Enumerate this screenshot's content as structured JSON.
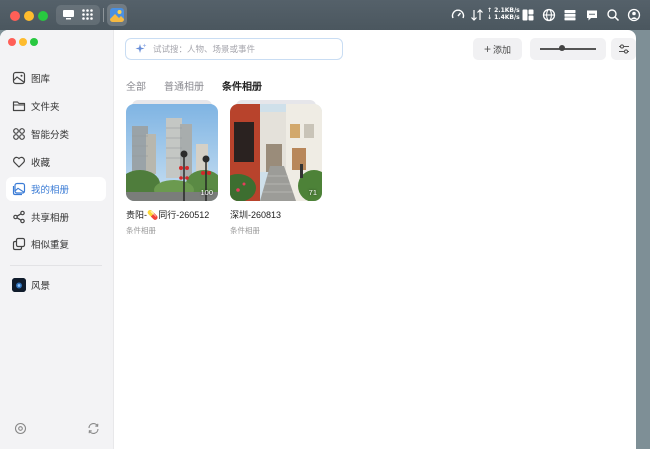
{
  "os_bar": {
    "net_up": "↑ 2.1KB/s",
    "net_down": "↓ 1.4KB/s",
    "icons": [
      "dashboard-icon",
      "apps-grid-icon",
      "photos-app-icon",
      "speed-gauge-icon",
      "widgets-icon",
      "globe-icon",
      "server-icon",
      "chat-icon",
      "search-icon",
      "user-icon"
    ]
  },
  "sidebar": {
    "items": [
      {
        "label": "图库",
        "icon": "gallery-icon"
      },
      {
        "label": "文件夹",
        "icon": "folder-icon"
      },
      {
        "label": "智能分类",
        "icon": "grid-icon"
      },
      {
        "label": "收藏",
        "icon": "heart-icon"
      },
      {
        "label": "我的相册",
        "icon": "album-icon",
        "active": true
      },
      {
        "label": "共享相册",
        "icon": "share-icon"
      },
      {
        "label": "相似重复",
        "icon": "duplicate-icon"
      }
    ],
    "pinned": [
      {
        "label": "风景",
        "icon": "scenery-thumbnail"
      }
    ],
    "bottom_icons": [
      "settings-icon",
      "sync-icon"
    ]
  },
  "toolbar": {
    "search_placeholder": "试试搜：人物、场景或事件",
    "add_label": "添加",
    "zoom_level": 0.4
  },
  "tabs": [
    {
      "label": "全部"
    },
    {
      "label": "普通相册"
    },
    {
      "label": "条件相册",
      "active": true
    }
  ],
  "albums": [
    {
      "name": "贵阳-💊同行-260512",
      "type": "条件相册",
      "count": "100"
    },
    {
      "name": "深圳-260813",
      "type": "条件相册",
      "count": "71"
    }
  ],
  "colors": {
    "accent": "#3a7bd5",
    "sidebar_bg": "#f3f3f5",
    "search_border": "#c9ddf3"
  }
}
